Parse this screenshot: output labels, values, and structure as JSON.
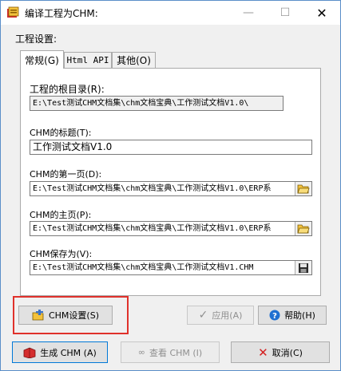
{
  "window": {
    "title": "编译工程为CHM:",
    "minimize": "—",
    "maximize": "☐",
    "close": "✕"
  },
  "group_label": "工程设置:",
  "tabs": [
    {
      "label": "常规(G)",
      "active": true
    },
    {
      "label": "Html API",
      "active": false
    },
    {
      "label": "其他(O)",
      "active": false
    }
  ],
  "fields": {
    "root_dir": {
      "label": "工程的根目录(R):",
      "value": "E:\\Test测试CHM文档集\\chm文档宝典\\工作测试文档V1.0\\"
    },
    "title": {
      "label": "CHM的标题(T):",
      "value": "工作测试文档V1.0"
    },
    "first_page": {
      "label": "CHM的第一页(D):",
      "value": "E:\\Test测试CHM文档集\\chm文档宝典\\工作测试文档V1.0\\ERP系"
    },
    "home_page": {
      "label": "CHM的主页(P):",
      "value": "E:\\Test测试CHM文档集\\chm文档宝典\\工作测试文档V1.0\\ERP系"
    },
    "save_as": {
      "label": "CHM保存为(V):",
      "value": "E:\\Test测试CHM文档集\\chm文档宝典\\工作测试文档V1.CHM"
    }
  },
  "buttons": {
    "chm_settings": "CHM设置(S)",
    "apply": "应用(A)",
    "help": "帮助(H)",
    "generate": "生成 CHM (A)",
    "view": "查看 CHM (I)",
    "cancel": "取消(C)"
  },
  "colors": {
    "highlight": "#e0312b",
    "focus": "#0078d7",
    "disabled_text": "#8f8f8f"
  }
}
